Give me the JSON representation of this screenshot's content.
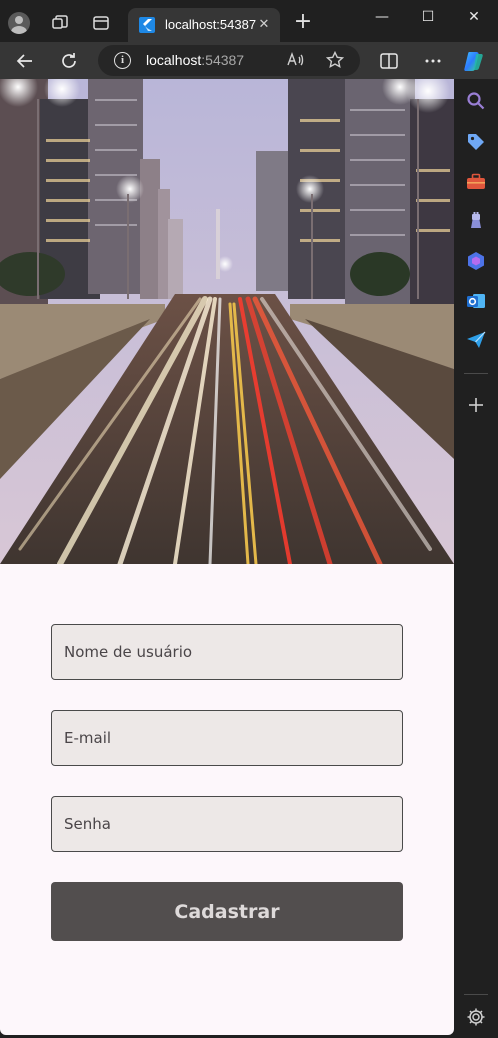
{
  "browser": {
    "tab_title": "localhost:54387",
    "tab_close_glyph": "✕",
    "new_tab_glyph": "+",
    "window_controls": [
      "—",
      "☐",
      "✕"
    ],
    "url_host": "localhost",
    "url_port": ":54387",
    "icons": {
      "profile": "profile-avatar-icon",
      "workspaces": "workspaces-icon",
      "tab_actions": "tab-actions-icon",
      "back": "back-arrow-icon",
      "refresh": "refresh-icon",
      "site_info": "info-icon",
      "read_aloud": "read-aloud-icon",
      "favorite": "star-icon",
      "split_screen": "split-screen-icon",
      "more": "more-options-icon",
      "copilot": "copilot-icon"
    }
  },
  "sidebar": {
    "items": [
      {
        "icon": "search-icon",
        "color": "#9a7fd6"
      },
      {
        "icon": "tag-icon",
        "color": "#6fa8f5"
      },
      {
        "icon": "toolbox-icon",
        "color": "#e0563c"
      },
      {
        "icon": "games-icon",
        "color": "#8a8fd8"
      },
      {
        "icon": "microsoft365-icon",
        "color": "#4d73e8"
      },
      {
        "icon": "outlook-icon",
        "color": "#1f8fe0"
      },
      {
        "icon": "send-icon",
        "color": "#2e9fe8"
      }
    ],
    "add_icon": "plus-icon",
    "settings_icon": "gear-icon"
  },
  "page": {
    "hero_image": "city-avenue-photo",
    "form": {
      "username_placeholder": "Nome de usuário",
      "email_placeholder": "E-mail",
      "password_placeholder": "Senha",
      "submit_label": "Cadastrar"
    }
  },
  "colors": {
    "page_background": "#fdf7fb",
    "field_fill": "#ede8e7",
    "button_fill": "#524e4e",
    "button_text": "#dedada"
  }
}
